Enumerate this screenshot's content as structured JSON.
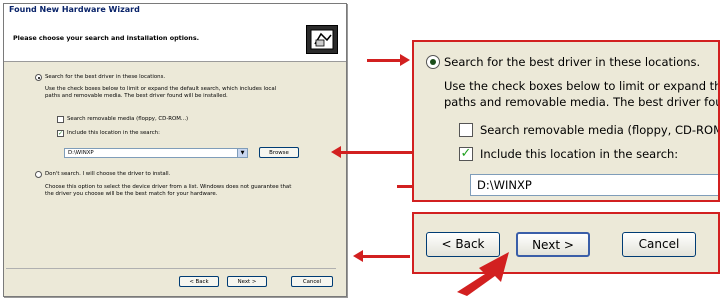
{
  "window": {
    "title": "Found New Hardware Wizard"
  },
  "header": {
    "title": "Please choose your search and installation options."
  },
  "options": {
    "search_best": "Search for the best driver in these locations.",
    "search_desc_line1": "Use the check boxes below to limit or expand the default search, which includes local",
    "search_desc_line2": "paths and removable media. The best driver found will be installed.",
    "removable_media": "Search removable media (floppy, CD-ROM...)",
    "include_location": "Include this location in the search:",
    "location_value": "D:\\WINXP",
    "browse": "Browse",
    "dont_search": "Don't search. I will choose the driver to install.",
    "dont_desc_line1": "Choose this option to select the device driver from a list.  Windows does not guarantee that",
    "dont_desc_line2": "the driver you choose will be the best match for your hardware."
  },
  "buttons": {
    "back": "< Back",
    "next": "Next >",
    "cancel": "Cancel"
  },
  "zoom_top": {
    "search_best": "Search for the best driver in these locations.",
    "desc_line1": "Use the check boxes below to limit or expand the de",
    "desc_line2": "paths and removable media.  The best driver found v",
    "removable_media": "Search removable media (floppy, CD-ROM...)",
    "include_location": "Include this location in the search:",
    "location_value": "D:\\WINXP"
  },
  "zoom_bottom": {
    "back": "< Back",
    "next": "Next >",
    "cancel": "Cancel"
  },
  "colors": {
    "accent": "#d22020",
    "dialog_bg": "#ece9d8"
  }
}
